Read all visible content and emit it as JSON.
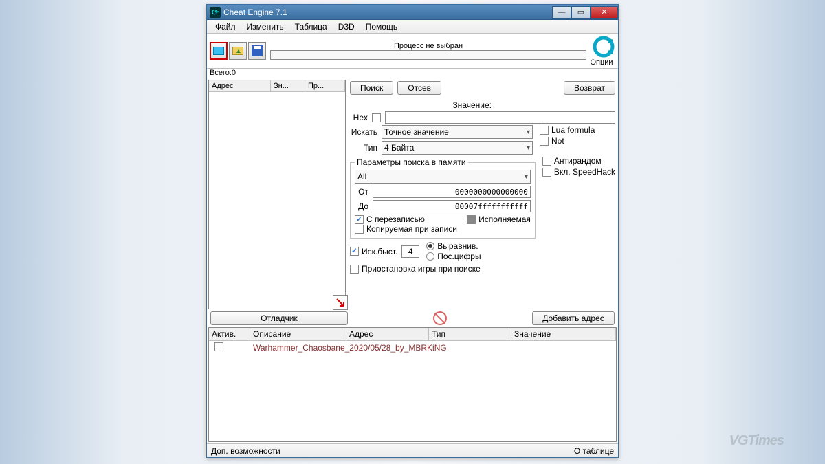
{
  "window": {
    "title": "Cheat Engine 7.1"
  },
  "menu": {
    "file": "Файл",
    "edit": "Изменить",
    "table": "Таблица",
    "d3d": "D3D",
    "help": "Помощь"
  },
  "toolbar": {
    "progress_label": "Процесс не выбран",
    "count_label": "Всего:",
    "count_value": "0",
    "options_label": "Опции"
  },
  "list_headers": {
    "address": "Адрес",
    "value": "Зн...",
    "prev": "Пр..."
  },
  "buttons": {
    "search": "Поиск",
    "sift": "Отсев",
    "restore": "Возврат",
    "debugger": "Отладчик",
    "add_address": "Добавить адрес"
  },
  "search": {
    "value_header": "Значение:",
    "hex_label": "Hex",
    "scan_label": "Искать",
    "scan_value": "Точное значение",
    "type_label": "Тип",
    "type_value": "4 Байта",
    "lua_label": "Lua formula",
    "not_label": "Not"
  },
  "memory": {
    "group_title": "Параметры поиска в памяти",
    "region": "All",
    "from_label": "От",
    "from_value": "0000000000000000",
    "to_label": "До",
    "to_value": "00007fffffffffff",
    "writable_label": "С перезаписью",
    "executable_label": "Исполняемая",
    "cow_label": "Копируемая при записи",
    "antirand_label": "Антирандом",
    "speedhack_label": "Вкл. SpeedHack"
  },
  "fast": {
    "enable_label": "Иск.быст.",
    "align_value": "4",
    "aligned_label": "Выравнив.",
    "lastdigits_label": "Пос.цифры"
  },
  "pause": {
    "label": "Приостановка игры при поиске"
  },
  "table": {
    "col_active": "Актив.",
    "col_desc": "Описание",
    "col_addr": "Адрес",
    "col_type": "Тип",
    "col_value": "Значение",
    "row0_desc": "Warhammer_Chaosbane_2020/05/28_by_MBRKiNG"
  },
  "status": {
    "left": "Доп. возможности",
    "right": "О таблице"
  },
  "watermark": "VGTimes"
}
